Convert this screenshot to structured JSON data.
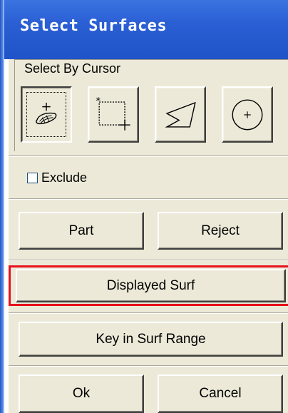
{
  "dialog": {
    "title": "Select Surfaces"
  },
  "select_by_cursor": {
    "label": "Select By Cursor",
    "tools": [
      {
        "name": "pick-surface",
        "icon": "surface-pick-icon",
        "active": true
      },
      {
        "name": "box-select",
        "icon": "rectangle-select-icon",
        "active": false
      },
      {
        "name": "polygon-select",
        "icon": "polygon-select-icon",
        "active": false
      },
      {
        "name": "circle-select",
        "icon": "circle-select-icon",
        "active": false
      }
    ]
  },
  "exclude": {
    "label": "Exclude",
    "checked": false
  },
  "buttons": {
    "part": "Part",
    "reject": "Reject",
    "displayed_surf": "Displayed Surf",
    "key_in_surf_range": "Key in Surf Range",
    "ok": "Ok",
    "cancel": "Cancel"
  },
  "colors": {
    "titlebar": "#2a5fd4",
    "panel": "#ece9d8",
    "highlight": "#e8101c"
  }
}
